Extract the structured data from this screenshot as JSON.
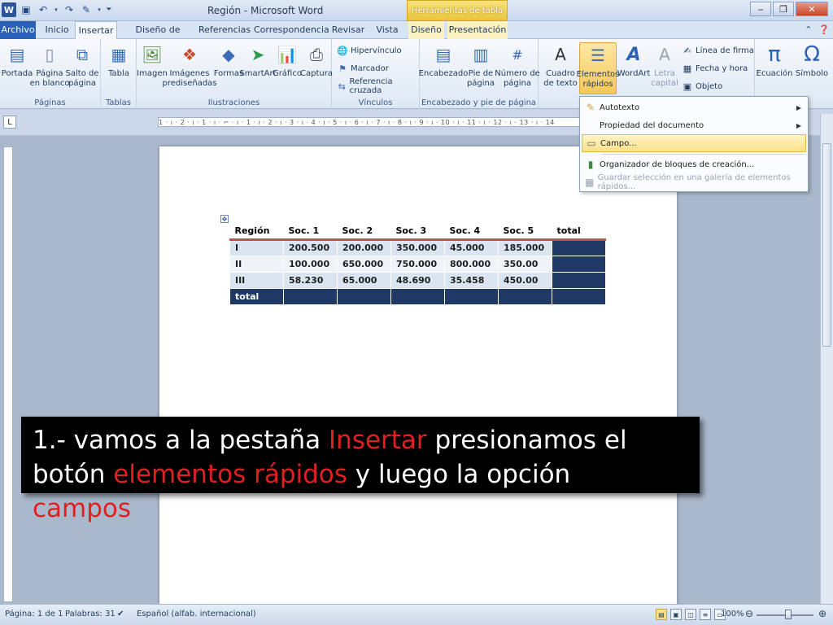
{
  "titlebar": {
    "title": "Región - Microsoft Word",
    "context_tab": "Herramientas de tabla"
  },
  "tabs": [
    "Archivo",
    "Inicio",
    "Insertar",
    "Diseño de página",
    "Referencias",
    "Correspondencia",
    "Revisar",
    "Vista",
    "Diseño",
    "Presentación"
  ],
  "ribbon": {
    "paginas": {
      "label": "Páginas",
      "portada": "Portada",
      "pagina_en_blanco": "Página\nen blanco",
      "salto_de_pagina": "Salto de\npágina"
    },
    "tablas": {
      "label": "Tablas",
      "tabla": "Tabla"
    },
    "ilustraciones": {
      "label": "Ilustraciones",
      "imagen": "Imagen",
      "imagenes_prediseñadas": "Imágenes\nprediseñadas",
      "formas": "Formas",
      "smartart": "SmartArt",
      "grafico": "Gráfico",
      "captura": "Captura"
    },
    "vinculos": {
      "label": "Vínculos",
      "hipervinculo": "Hipervínculo",
      "marcador": "Marcador",
      "referencia_cruzada": "Referencia cruzada"
    },
    "encabezado": {
      "label": "Encabezado y pie de página",
      "encabezado": "Encabezado",
      "pie_de_pagina": "Pie de\npágina",
      "numero_de_pagina": "Número de\npágina"
    },
    "texto": {
      "cuadro_de_texto": "Cuadro\nde texto",
      "elementos_rapidos": "Elementos\nrápidos",
      "wordart": "WordArt",
      "letra_capital": "Letra\ncapital",
      "linea_de_firma": "Línea de firma",
      "fecha_y_hora": "Fecha y hora",
      "objeto": "Objeto"
    },
    "simbolos": {
      "ecuacion": "Ecuación",
      "simbolo": "Símbolo"
    }
  },
  "dropdown": {
    "items": [
      "Autotexto",
      "Propiedad del documento",
      "Campo...",
      "Organizador de bloques de creación...",
      "Guardar selección en una galería de elementos rápidos..."
    ]
  },
  "table": {
    "headers": [
      "Región",
      "Soc. 1",
      "Soc. 2",
      "Soc. 3",
      "Soc. 4",
      "Soc. 5",
      "total"
    ],
    "rows": [
      [
        "I",
        "200.500",
        "200.000",
        "350.000",
        "45.000",
        "185.000",
        ""
      ],
      [
        "II",
        "100.000",
        "650.000",
        "750.000",
        "800.000",
        "350.00",
        ""
      ],
      [
        "III",
        "58.230",
        "65.000",
        "48.690",
        "35.458",
        "450.00",
        ""
      ],
      [
        "total",
        "",
        "",
        "",
        "",
        "",
        ""
      ]
    ]
  },
  "annotation": {
    "part1": "1.- vamos a la pestaña ",
    "part2": "Insertar",
    "part3": " presionamos el botón ",
    "part4": "elementos rápidos",
    "part5": " y luego la opción ",
    "part6": "campos"
  },
  "statusbar": {
    "page": "Página: 1 de 1",
    "words": "Palabras: 31",
    "language": "Español (alfab. internacional)",
    "zoom": "100%"
  },
  "ruler": {
    "ticks": "1 · ı · 2 · ı · 1 · ı · ⌐ · ı · 1 · ı · 2 · ı · 3 · ı · 4 · ı · 5 · ı · 6 · ı · 7 · ı · 8 · ı · 9 · ı · 10 · ı · 11 · ı · 12 · ı · 13 · ı · 14"
  },
  "colors": {
    "accent_red": "#e02020",
    "table_dark": "#1f3864",
    "table_red_line": "#c0504d",
    "highlight": "#fde18a"
  }
}
